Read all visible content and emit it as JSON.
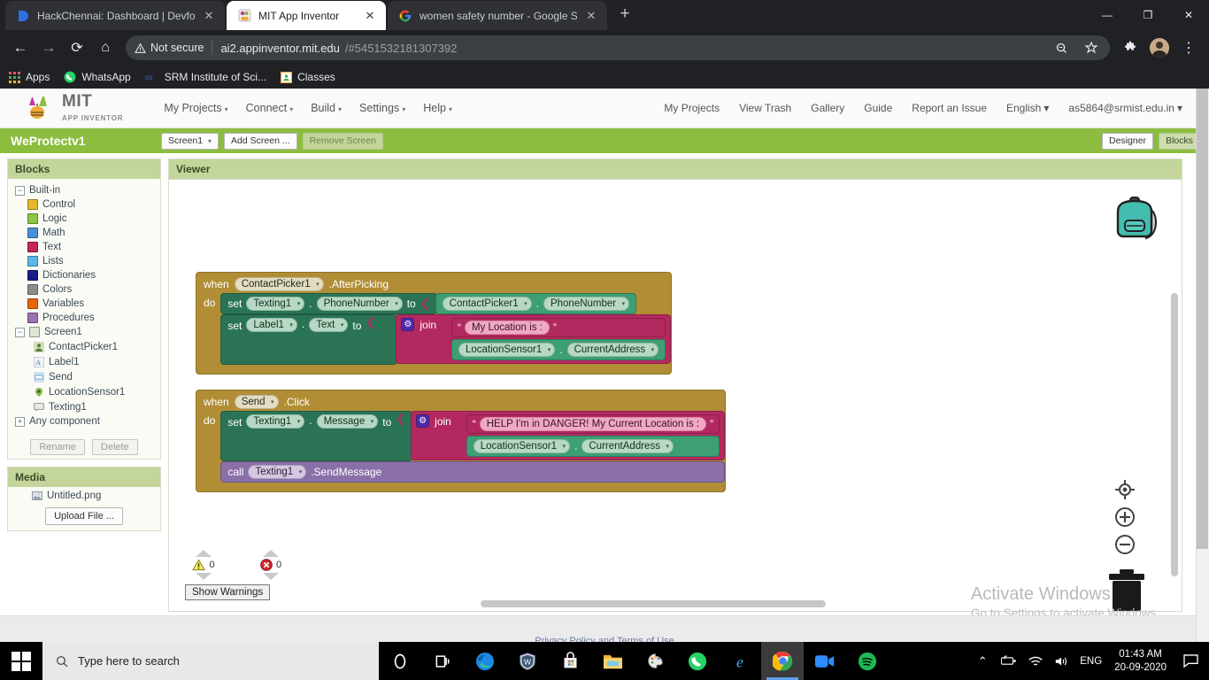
{
  "browser": {
    "tabs": [
      {
        "title": "HackChennai: Dashboard | Devfo",
        "favicon": "devfolio-icon",
        "active": false
      },
      {
        "title": "MIT App Inventor",
        "favicon": "mit-app-inventor-icon",
        "active": true
      },
      {
        "title": "women safety number - Google S",
        "favicon": "google-icon",
        "active": false
      }
    ],
    "new_tab_label": "+",
    "window_controls": {
      "minimize": "—",
      "maximize": "❐",
      "close": "✕"
    },
    "nav": {
      "back": "←",
      "forward": "→",
      "reload": "⟳",
      "home": "⌂"
    },
    "security_label": "Not secure",
    "url_host": "ai2.appinventor.mit.edu",
    "url_path": "/#5451532181307392",
    "bookmarks": [
      {
        "label": "Apps",
        "icon": "apps-grid-icon"
      },
      {
        "label": "WhatsApp",
        "icon": "whatsapp-icon"
      },
      {
        "label": "SRM Institute of Sci...",
        "icon": "coursera-icon"
      },
      {
        "label": "Classes",
        "icon": "classroom-icon"
      }
    ]
  },
  "appinventor": {
    "logo": {
      "title": "MIT",
      "subtitle": "APP INVENTOR"
    },
    "menu": [
      {
        "label": "My Projects",
        "caret": true
      },
      {
        "label": "Connect",
        "caret": true
      },
      {
        "label": "Build",
        "caret": true
      },
      {
        "label": "Settings",
        "caret": true
      },
      {
        "label": "Help",
        "caret": true
      }
    ],
    "right_menu": [
      {
        "label": "My Projects",
        "caret": false
      },
      {
        "label": "View Trash",
        "caret": false
      },
      {
        "label": "Gallery",
        "caret": false
      },
      {
        "label": "Guide",
        "caret": false
      },
      {
        "label": "Report an Issue",
        "caret": false
      },
      {
        "label": "English",
        "caret": true
      },
      {
        "label": "as5864@srmist.edu.in",
        "caret": true
      }
    ],
    "project_title": "WeProtectv1",
    "screen_selector": "Screen1",
    "add_screen_label": "Add Screen ...",
    "remove_screen_label": "Remove Screen",
    "designer_label": "Designer",
    "blocks_label": "Blocks",
    "blocks_panel_title": "Blocks",
    "viewer_title": "Viewer",
    "media_panel_title": "Media",
    "rename_label": "Rename",
    "delete_label": "Delete",
    "media_file": "Untitled.png",
    "upload_label": "Upload File ...",
    "tree": {
      "builtin_label": "Built-in",
      "builtin_items": [
        {
          "label": "Control",
          "color": "#E8B82A"
        },
        {
          "label": "Logic",
          "color": "#8EC63F"
        },
        {
          "label": "Math",
          "color": "#4A90D9"
        },
        {
          "label": "Text",
          "color": "#C4255A"
        },
        {
          "label": "Lists",
          "color": "#56B9E8"
        },
        {
          "label": "Dictionaries",
          "color": "#1B1B8A"
        },
        {
          "label": "Colors",
          "color": "#8D8D8D"
        },
        {
          "label": "Variables",
          "color": "#E8650A"
        },
        {
          "label": "Procedures",
          "color": "#9B72B0"
        }
      ],
      "screen_label": "Screen1",
      "components": [
        {
          "label": "ContactPicker1",
          "icon": "contact-picker-icon"
        },
        {
          "label": "Label1",
          "icon": "label-icon"
        },
        {
          "label": "Send",
          "icon": "button-icon"
        },
        {
          "label": "LocationSensor1",
          "icon": "location-sensor-icon"
        },
        {
          "label": "Texting1",
          "icon": "texting-icon"
        }
      ],
      "any_component_label": "Any component"
    },
    "warnings": {
      "warning_count": "0",
      "error_count": "0",
      "show_warnings_label": "Show Warnings"
    },
    "footer_text": "Privacy Policy and Terms of Use",
    "blocks": {
      "group1": {
        "when_label": "when",
        "event_component": "ContactPicker1",
        "event_name": ".AfterPicking",
        "do_label": "do",
        "statements": [
          {
            "kind": "set",
            "set_label": "set",
            "component": "Texting1",
            "dot": ".",
            "property": "PhoneNumber",
            "to_label": "to",
            "value_component": "ContactPicker1",
            "value_dot": ".",
            "value_property": "PhoneNumber"
          },
          {
            "kind": "set_join",
            "set_label": "set",
            "component": "Label1",
            "dot": ".",
            "property": "Text",
            "to_label": "to",
            "join_label": "join",
            "gear": "⚙",
            "string_open": "“",
            "string_value": "My Location is : ",
            "string_close": "”",
            "getter_component": "LocationSensor1",
            "getter_dot": ".",
            "getter_property": "CurrentAddress"
          }
        ]
      },
      "group2": {
        "when_label": "when",
        "event_component": "Send",
        "event_name": ".Click",
        "do_label": "do",
        "statements": [
          {
            "kind": "set_join",
            "set_label": "set",
            "component": "Texting1",
            "dot": ".",
            "property": "Message",
            "to_label": "to",
            "join_label": "join",
            "gear": "⚙",
            "string_open": "“",
            "string_value": "HELP I'm in DANGER! My Current Location is : ",
            "string_close": "”",
            "getter_component": "LocationSensor1",
            "getter_dot": ".",
            "getter_property": "CurrentAddress"
          },
          {
            "kind": "call",
            "call_label": "call",
            "component": "Texting1",
            "method": ".SendMessage"
          }
        ]
      }
    }
  },
  "watermark": {
    "line1": "Activate Windows",
    "line2": "Go to Settings to activate Windows."
  },
  "taskbar": {
    "search_placeholder": "Type here to search",
    "icons": [
      {
        "name": "cortana-icon"
      },
      {
        "name": "task-view-icon"
      },
      {
        "name": "microsoft-edge-icon"
      },
      {
        "name": "windows-defender-icon"
      },
      {
        "name": "microsoft-store-icon"
      },
      {
        "name": "file-explorer-icon"
      },
      {
        "name": "paint-icon"
      },
      {
        "name": "whatsapp-icon"
      },
      {
        "name": "internet-explorer-icon"
      },
      {
        "name": "google-chrome-icon"
      },
      {
        "name": "zoom-icon"
      },
      {
        "name": "spotify-icon"
      }
    ],
    "tray": {
      "chevron": "⌃",
      "battery": "battery-icon",
      "wifi": "wifi-icon",
      "volume": "volume-icon",
      "language": "ENG",
      "time": "01:43 AM",
      "date": "20-09-2020",
      "action_center": "notification-icon"
    }
  }
}
